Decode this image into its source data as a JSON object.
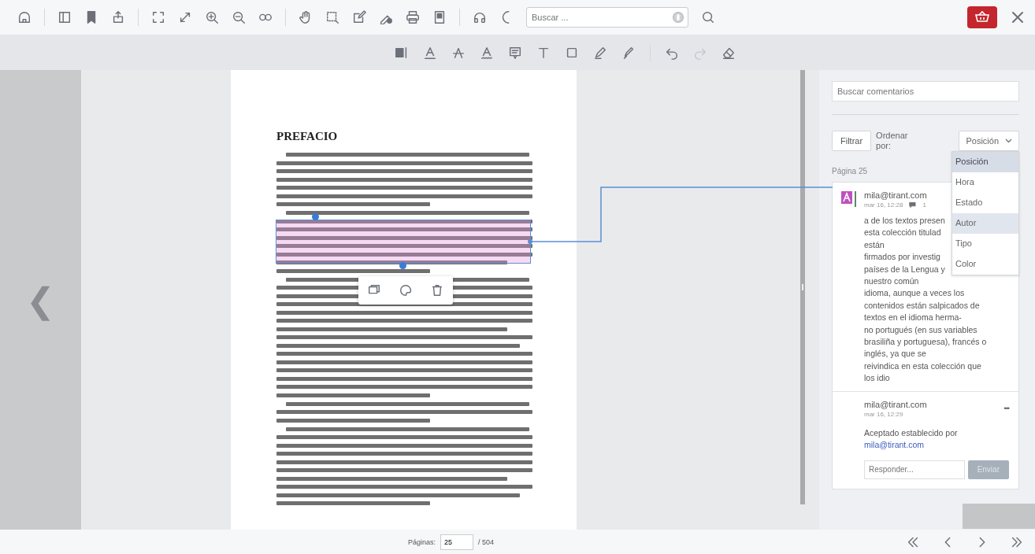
{
  "toolbar": {
    "search": {
      "placeholder": "Buscar ..."
    }
  },
  "document": {
    "heading": "PREFACIO"
  },
  "side_nav": {
    "prev_glyph": "❮"
  },
  "comments_panel": {
    "search": {
      "placeholder": "Buscar comentarios"
    },
    "filter_button": "Filtrar",
    "sort_label": "Ordenar\npor:",
    "sort_select": "Posición",
    "sort_options": [
      {
        "label": "Posición",
        "selected": true,
        "hovered": false
      },
      {
        "label": "Hora",
        "selected": false,
        "hovered": false
      },
      {
        "label": "Estado",
        "selected": false,
        "hovered": false
      },
      {
        "label": "Autor",
        "selected": false,
        "hovered": true
      },
      {
        "label": "Tipo",
        "selected": false,
        "hovered": false
      },
      {
        "label": "Color",
        "selected": false,
        "hovered": false
      }
    ],
    "page_label": "Página 25",
    "comment": {
      "color": "#c050c0",
      "author": "mila@tirant.com",
      "time": "mar 16, 12:28",
      "reply_count": "1",
      "lines": [
        "a de los textos presen",
        "esta colección titulad",
        "están",
        "firmados por investig",
        "países de la Lengua y",
        "nuestro común",
        "idioma, aunque a veces los",
        "contenidos están salpicados de",
        "textos en el idioma herma-",
        "no portugués (en sus variables",
        "brasiliña y portuguesa), francés o",
        "inglés, ya que se",
        "reivindica en esta colección que",
        "los idio"
      ]
    },
    "reply": {
      "author": "mila@tirant.com",
      "time": "mar 16, 12:29",
      "text": "Aceptado establecido por",
      "link": "mila@tirant.com",
      "more": "•••"
    },
    "reply_field": {
      "placeholder": "Responder..."
    },
    "send_button": "Enviar"
  },
  "pager": {
    "label": "Páginas:",
    "page": "25",
    "total": "/ 504"
  }
}
